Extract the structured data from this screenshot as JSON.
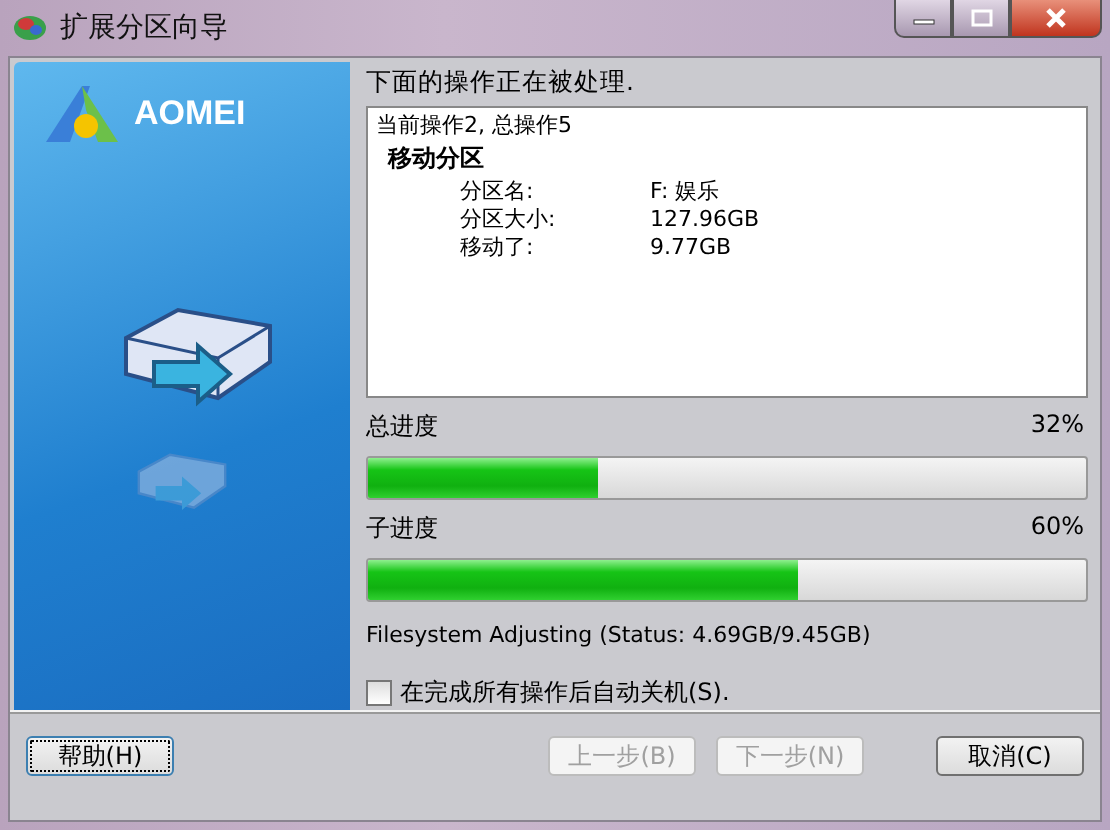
{
  "window": {
    "title": "扩展分区向导"
  },
  "sidebar": {
    "logo": "AOMEI"
  },
  "heading": "下面的操作正在被处理.",
  "operations": {
    "summary": "当前操作2, 总操作5",
    "title": "移动分区",
    "fields": [
      {
        "label": "分区名:",
        "value": "F: 娱乐"
      },
      {
        "label": "分区大小:",
        "value": "127.96GB"
      },
      {
        "label": "移动了:",
        "value": "9.77GB"
      }
    ]
  },
  "progress": [
    {
      "label": "总进度",
      "reading": "32%",
      "level": 0.32
    },
    {
      "label": "子进度",
      "reading": "60%",
      "level": 0.6
    }
  ],
  "status": "Filesystem Adjusting (Status: 4.69GB/9.45GB)",
  "shutdown": {
    "label": "在完成所有操作后自动关机(S).",
    "checked": false
  },
  "buttons": [
    {
      "label": "帮助(H)",
      "disabled": false,
      "focused": true
    },
    {
      "label": "上一步(B)",
      "disabled": true,
      "focused": false
    },
    {
      "label": "下一步(N)",
      "disabled": true,
      "focused": false
    },
    {
      "label": "取消(C)",
      "disabled": false,
      "focused": false
    }
  ]
}
